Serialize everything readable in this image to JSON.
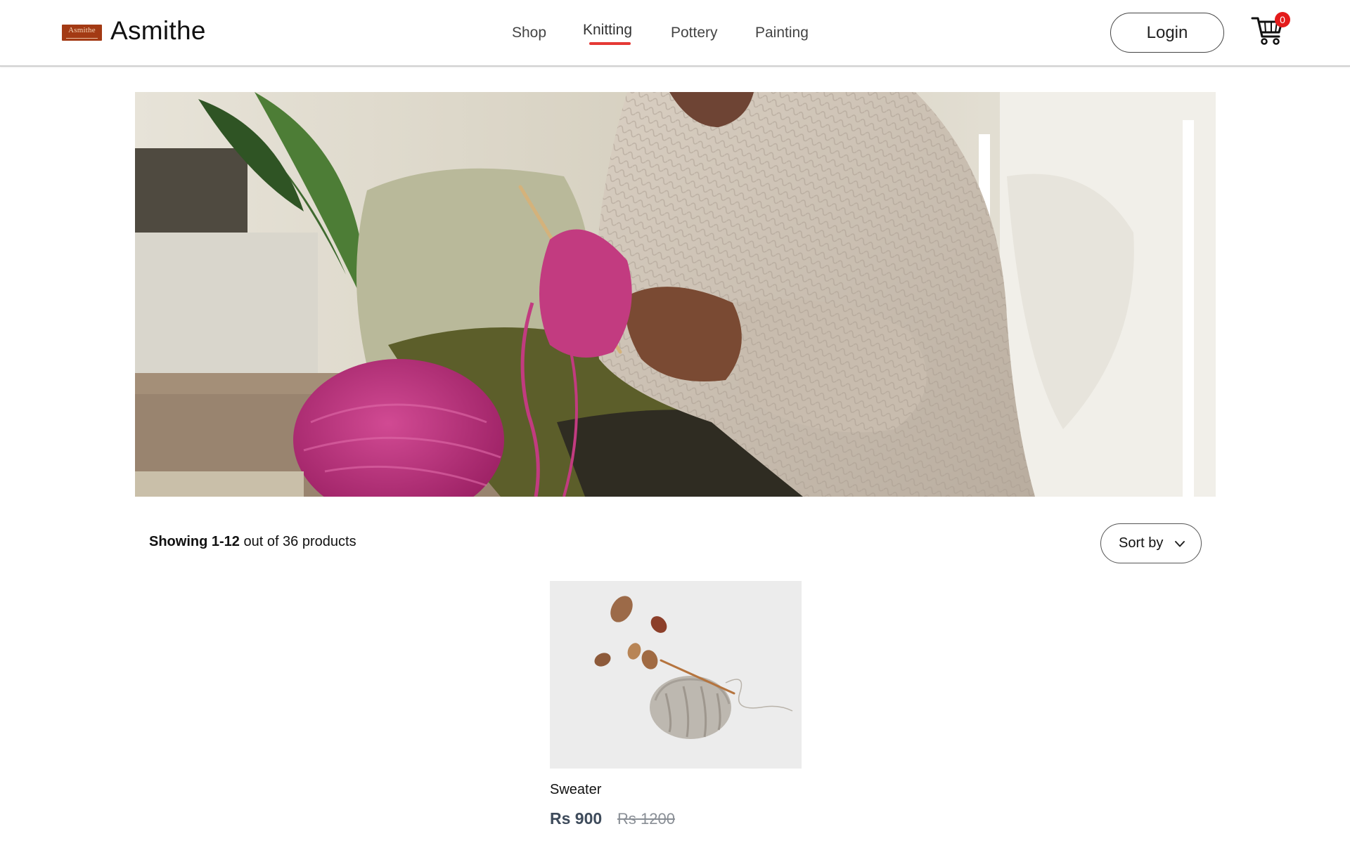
{
  "brand": {
    "logo_text": "Asmithe",
    "name": "Asmithe",
    "logo_color": "#a33a14"
  },
  "nav": {
    "items": [
      {
        "label": "Shop",
        "active": false
      },
      {
        "label": "Knitting",
        "active": true
      },
      {
        "label": "Pottery",
        "active": false
      },
      {
        "label": "Painting",
        "active": false
      }
    ],
    "active_indicator_color": "#e53935"
  },
  "header": {
    "login_label": "Login",
    "cart_icon": "cart-icon",
    "cart_count": "0",
    "cart_badge_color": "#e41b1b"
  },
  "hero": {
    "image": "knitting-hero-photo"
  },
  "results": {
    "showing_range": "Showing 1-12",
    "total_text": " out of 36 products",
    "sort_label": "Sort by",
    "sort_icon": "chevron-down-icon"
  },
  "products": [
    {
      "name": "Sweater",
      "price": "Rs 900",
      "old_price": "Rs 1200",
      "image": "knitted-sweater-photo"
    }
  ]
}
